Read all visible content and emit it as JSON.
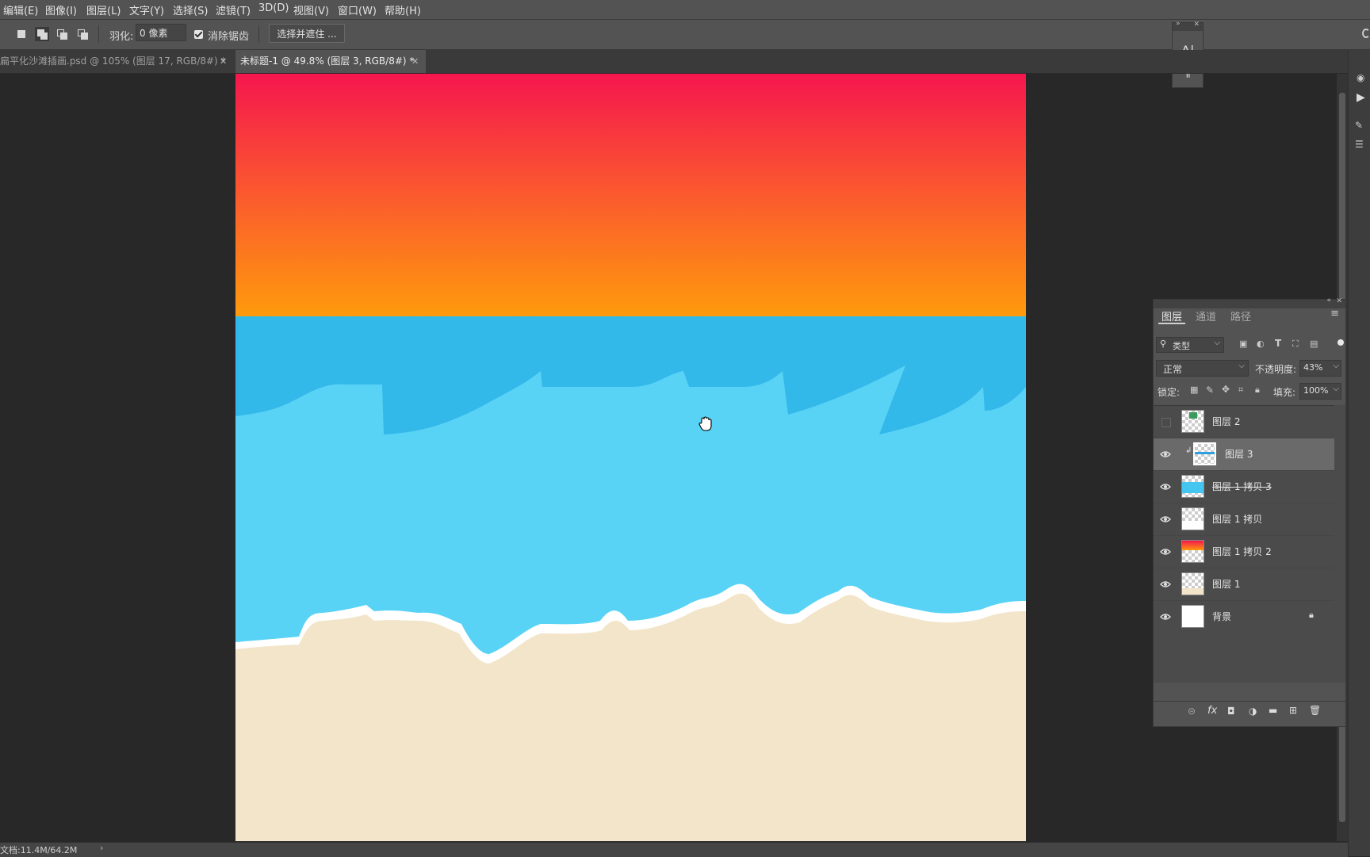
{
  "menu": [
    "编辑(E)",
    "图像(I)",
    "图层(L)",
    "文字(Y)",
    "选择(S)",
    "滤镜(T)",
    "3D(D)",
    "视图(V)",
    "窗口(W)",
    "帮助(H)"
  ],
  "options": {
    "feather_label": "羽化:",
    "feather_value": "0 像素",
    "antialias_label": "消除锯齿",
    "select_mask_button": "选择并遮住 ..."
  },
  "tabs": [
    {
      "label": "扁平化沙滩插画.psd @ 105% (图层 17, RGB/8#) *",
      "active": false
    },
    {
      "label": "未标题-1 @ 49.8% (图层 3, RGB/8#) *",
      "active": true
    }
  ],
  "char_panel": {
    "type_icon": "A|",
    "para_icon": "¶"
  },
  "layers_panel": {
    "tabs": [
      "图层",
      "通道",
      "路径"
    ],
    "filter_kind": "类型",
    "blend_mode": "正常",
    "opacity_label": "不透明度:",
    "opacity_value": "43%",
    "lock_label": "锁定:",
    "fill_label": "填充:",
    "fill_value": "100%",
    "layers": [
      {
        "name": "图层 2",
        "visible": false,
        "selected": false,
        "thumb": "checker-figure"
      },
      {
        "name": "图层 3",
        "visible": true,
        "selected": true,
        "thumb": "checker-blue-line",
        "clipped": true
      },
      {
        "name": "图层 1 拷贝 3",
        "visible": true,
        "selected": false,
        "thumb": "checker-blue",
        "strikethrough": true
      },
      {
        "name": "图层 1 拷贝",
        "visible": true,
        "selected": false,
        "thumb": "checker-white"
      },
      {
        "name": "图层 1 拷贝 2",
        "visible": true,
        "selected": false,
        "thumb": "checker-gradient"
      },
      {
        "name": "图层 1",
        "visible": true,
        "selected": false,
        "thumb": "checker-sand"
      },
      {
        "name": "背景",
        "visible": true,
        "selected": false,
        "thumb": "white",
        "locked": true
      }
    ]
  },
  "status": {
    "doc_size": "文档:11.4M/64.2M"
  },
  "colors": {
    "sky_top": "#f5164e",
    "sky_bottom": "#fe9a0c",
    "sea_dark": "#33b8ea",
    "sea_light": "#58d3f5",
    "foam": "#ffffff",
    "sand": "#f2e5c9"
  }
}
